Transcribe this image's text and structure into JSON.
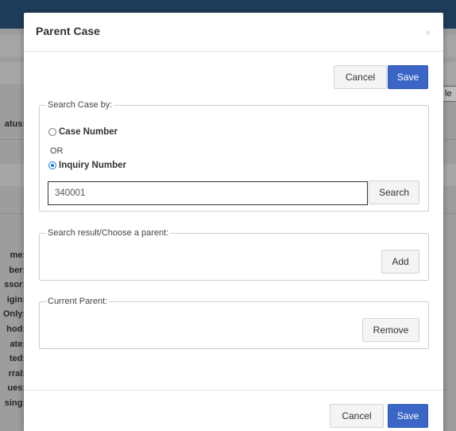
{
  "background": {
    "status_label": "atus:",
    "field_labels": [
      "me:",
      "ber:",
      "ssor:",
      "igin:",
      "Only:",
      "hod:",
      "ate:",
      "ted:",
      "rral:",
      "ues:",
      "sing:"
    ],
    "right_button": "le"
  },
  "modal": {
    "title": "Parent Case",
    "close": "×",
    "top_actions": {
      "cancel": "Cancel",
      "save": "Save"
    },
    "search_by": {
      "legend": "Search Case by:",
      "option_case": "Case Number",
      "or": "OR",
      "option_inquiry": "Inquiry Number",
      "selected": "Inquiry Number",
      "input_value": "340001",
      "search_button": "Search"
    },
    "results": {
      "legend": "Search result/Choose a parent:",
      "add_button": "Add"
    },
    "current_parent": {
      "legend": "Current Parent:",
      "remove_button": "Remove"
    },
    "footer": {
      "cancel": "Cancel",
      "save": "Save"
    }
  },
  "colors": {
    "primary": "#3c66c5",
    "topbar": "#1f3d5a",
    "overlay": "#9d9d9d"
  }
}
